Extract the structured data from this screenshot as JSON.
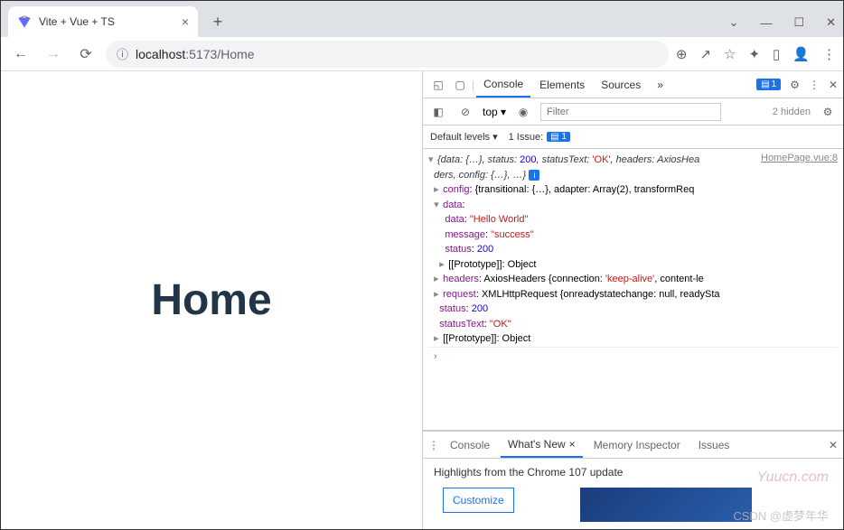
{
  "tab": {
    "title": "Vite + Vue + TS"
  },
  "address": {
    "host": "localhost",
    "port": ":5173",
    "path": "/Home"
  },
  "page": {
    "heading": "Home"
  },
  "devtools": {
    "tabs": {
      "console": "Console",
      "elements": "Elements",
      "sources": "Sources",
      "more": "»",
      "badge": "1"
    },
    "filter": {
      "top": "top ▾",
      "placeholder": "Filter",
      "hidden": "2 hidden"
    },
    "levels": {
      "default": "Default levels ▾",
      "issue": "1 Issue:",
      "issue_count": "1"
    },
    "source_link": "HomePage.vue:8",
    "log": {
      "line1_a": "{data: {…}, status: ",
      "line1_b": ", statusText: ",
      "line1_c": ", headers: AxiosHea",
      "status200": "200",
      "ok": "'OK'",
      "line2": "ders, config: {…}, …}",
      "config_k": "config",
      "config_v": ": {transitional: {…}, adapter: Array(2), transformReq",
      "data_k": "data",
      "inner_data_k": "data",
      "inner_data_v": "\"Hello World\"",
      "message_k": "message",
      "message_v": "\"success\"",
      "status_k": "status",
      "status_v": "200",
      "proto": "[[Prototype]]",
      "proto_v": ": Object",
      "headers_k": "headers",
      "headers_v": ": AxiosHeaders {connection: ",
      "keepalive": "'keep-alive'",
      "headers_v2": ", content-le",
      "request_k": "request",
      "request_v": ": XMLHttpRequest {onreadystatechange: null, readySta",
      "statustext_k": "statusText",
      "statustext_v": "\"OK\""
    },
    "drawer": {
      "tabs": {
        "console": "Console",
        "whatsnew": "What's New",
        "memory": "Memory Inspector",
        "issues": "Issues"
      },
      "highlights": "Highlights from the Chrome 107 update",
      "customize": "Customize"
    }
  },
  "watermark1": "Yuucn.com",
  "watermark2": "CSDN @虚梦年华"
}
